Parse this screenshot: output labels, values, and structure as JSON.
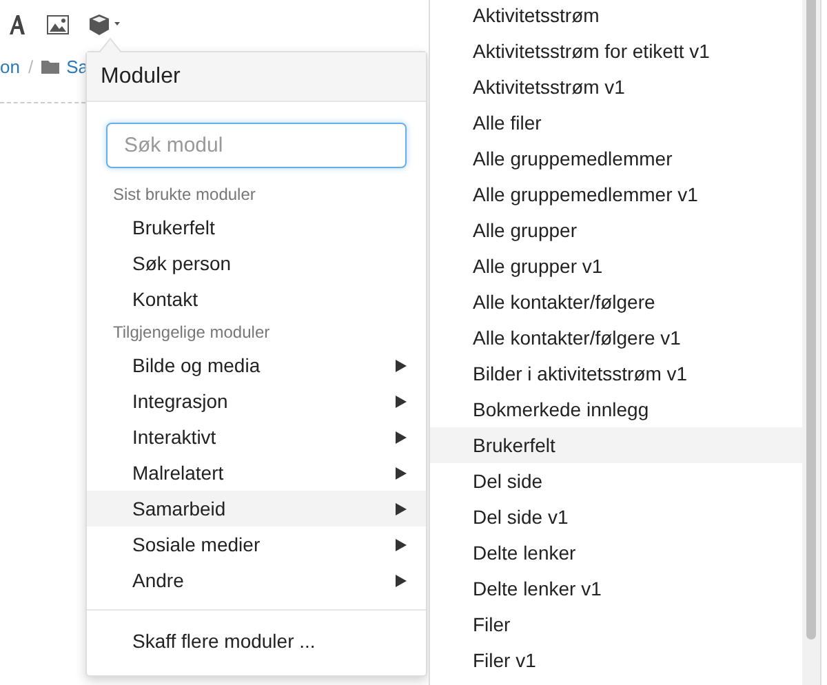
{
  "breadcrumb": {
    "separator": "/",
    "items": [
      {
        "label": "on",
        "kind": "link"
      },
      {
        "label": "Sa",
        "kind": "folder"
      }
    ]
  },
  "modules_menu": {
    "title": "Moduler",
    "search": {
      "placeholder": "Søk modul"
    },
    "sections": [
      {
        "heading": "Sist brukte moduler",
        "items": [
          {
            "label": "Brukerfelt",
            "has_submenu": false,
            "selected": false
          },
          {
            "label": "Søk person",
            "has_submenu": false,
            "selected": false
          },
          {
            "label": "Kontakt",
            "has_submenu": false,
            "selected": false
          }
        ]
      },
      {
        "heading": "Tilgjengelige moduler",
        "items": [
          {
            "label": "Bilde og media",
            "has_submenu": true,
            "selected": false
          },
          {
            "label": "Integrasjon",
            "has_submenu": true,
            "selected": false
          },
          {
            "label": "Interaktivt",
            "has_submenu": true,
            "selected": false
          },
          {
            "label": "Malrelatert",
            "has_submenu": true,
            "selected": false
          },
          {
            "label": "Samarbeid",
            "has_submenu": true,
            "selected": true
          },
          {
            "label": "Sosiale medier",
            "has_submenu": true,
            "selected": false
          },
          {
            "label": "Andre",
            "has_submenu": true,
            "selected": false
          }
        ]
      }
    ],
    "footer_link": "Skaff flere moduler ..."
  },
  "submenu": {
    "items": [
      {
        "label": "Aktivitetsstrøm",
        "selected": false
      },
      {
        "label": "Aktivitetsstrøm for etikett v1",
        "selected": false
      },
      {
        "label": "Aktivitetsstrøm v1",
        "selected": false
      },
      {
        "label": "Alle filer",
        "selected": false
      },
      {
        "label": "Alle gruppemedlemmer",
        "selected": false
      },
      {
        "label": "Alle gruppemedlemmer v1",
        "selected": false
      },
      {
        "label": "Alle grupper",
        "selected": false
      },
      {
        "label": "Alle grupper v1",
        "selected": false
      },
      {
        "label": "Alle kontakter/følgere",
        "selected": false
      },
      {
        "label": "Alle kontakter/følgere v1",
        "selected": false
      },
      {
        "label": "Bilder i aktivitetsstrøm v1",
        "selected": false
      },
      {
        "label": "Bokmerkede innlegg",
        "selected": false
      },
      {
        "label": "Brukerfelt",
        "selected": true
      },
      {
        "label": "Del side",
        "selected": false
      },
      {
        "label": "Del side v1",
        "selected": false
      },
      {
        "label": "Delte lenker",
        "selected": false
      },
      {
        "label": "Delte lenker v1",
        "selected": false
      },
      {
        "label": "Filer",
        "selected": false
      },
      {
        "label": "Filer v1",
        "selected": false
      }
    ]
  }
}
